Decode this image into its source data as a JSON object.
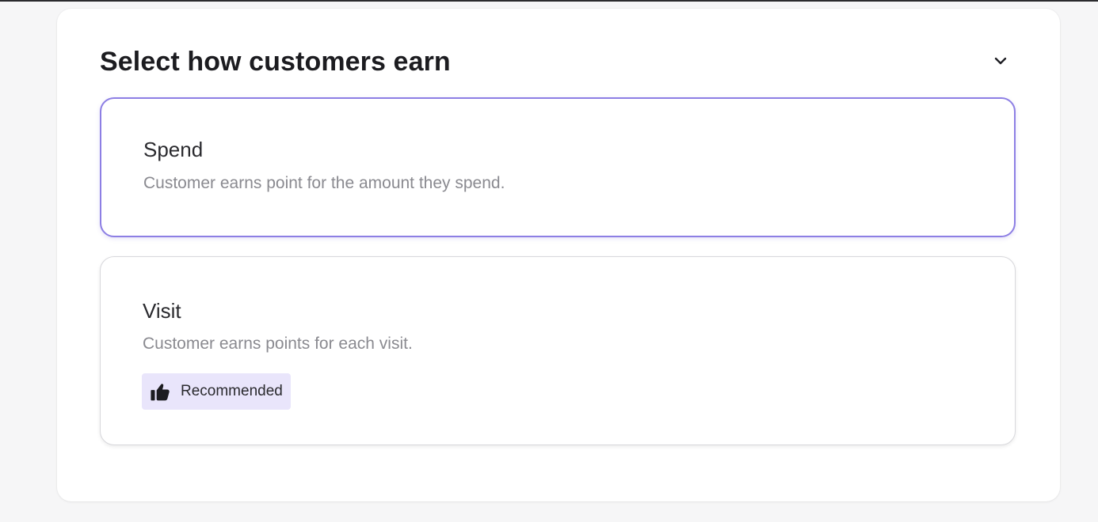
{
  "earn_section": {
    "title": "Select how customers earn",
    "collapse_icon": "chevron-down-icon",
    "options": [
      {
        "title": "Spend",
        "description": "Customer earns point for the amount they spend.",
        "selected": true
      },
      {
        "title": "Visit",
        "description": "Customer earns points for each visit.",
        "selected": false,
        "badge": {
          "icon": "thumbs-up-icon",
          "label": "Recommended"
        }
      }
    ]
  },
  "colors": {
    "selected_border": "#8d7fe4",
    "badge_background": "#e9e5fb",
    "description_text": "#8a8a90",
    "card_border": "#d8d8dc"
  }
}
